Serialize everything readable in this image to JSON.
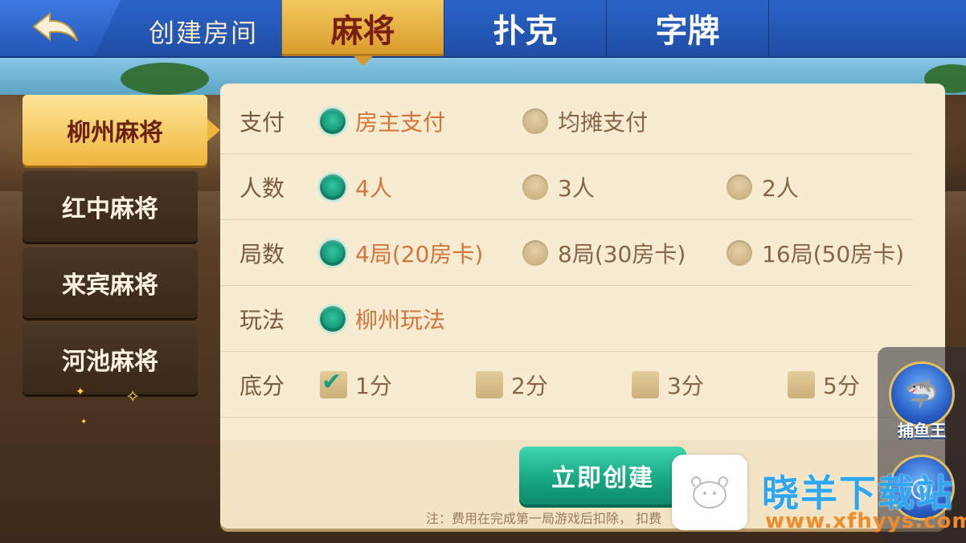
{
  "header": {
    "create_room": "创建房间",
    "tabs": [
      {
        "label": "麻将",
        "active": true
      },
      {
        "label": "扑克",
        "active": false
      },
      {
        "label": "字牌",
        "active": false
      }
    ]
  },
  "sidebar": {
    "items": [
      {
        "label": "柳州麻将",
        "active": true
      },
      {
        "label": "红中麻将",
        "active": false
      },
      {
        "label": "来宾麻将",
        "active": false
      },
      {
        "label": "河池麻将",
        "active": false
      }
    ]
  },
  "form": {
    "payment": {
      "label": "支付",
      "options": [
        "房主支付",
        "均摊支付"
      ],
      "selected": "房主支付"
    },
    "players": {
      "label": "人数",
      "options": [
        "4人",
        "3人",
        "2人"
      ],
      "selected": "4人"
    },
    "rounds": {
      "label": "局数",
      "options": [
        "4局(20房卡)",
        "8局(30房卡)",
        "16局(50房卡)"
      ],
      "selected": "4局(20房卡)"
    },
    "mode": {
      "label": "玩法",
      "options": [
        "柳州玩法"
      ],
      "selected": "柳州玩法"
    },
    "base_score": {
      "label": "底分",
      "options": [
        "1分",
        "2分",
        "3分",
        "5分"
      ],
      "checked": [
        "1分"
      ]
    }
  },
  "actions": {
    "create_now": "立即创建",
    "note": "注：费用在完成第一局游戏后扣除，                    扣费"
  },
  "side_games": [
    {
      "label": "捕鱼王",
      "icon": "shark-icon"
    }
  ],
  "watermark": {
    "title": "晓羊下载站",
    "url": "www.xfhyys.com"
  },
  "colors": {
    "topbar": "#2a63c8",
    "active_tab": "#e7b040",
    "panel": "#f7ecd2",
    "selected_option": "#d4743a",
    "create_button": "#17a983"
  }
}
